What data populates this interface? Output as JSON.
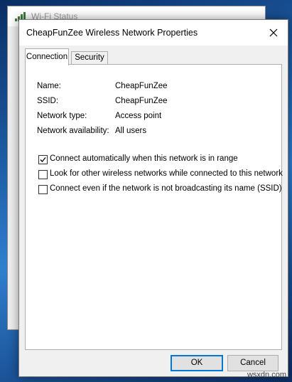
{
  "background_window": {
    "title": "Wi-Fi Status"
  },
  "dialog": {
    "title": "CheapFunZee Wireless Network Properties",
    "tabs": [
      {
        "label": "Connection",
        "active": true
      },
      {
        "label": "Security",
        "active": false
      }
    ],
    "info": [
      {
        "label": "Name:",
        "value": "CheapFunZee"
      },
      {
        "label": "SSID:",
        "value": "CheapFunZee"
      },
      {
        "label": "Network type:",
        "value": "Access point"
      },
      {
        "label": "Network availability:",
        "value": "All users"
      }
    ],
    "options": [
      {
        "label": "Connect automatically when this network is in range",
        "checked": true
      },
      {
        "label": "Look for other wireless networks while connected to this network",
        "checked": false
      },
      {
        "label": "Connect even if the network is not broadcasting its name (SSID)",
        "checked": false
      }
    ],
    "buttons": {
      "ok": "OK",
      "cancel": "Cancel"
    }
  },
  "watermark": "wsxdn.com",
  "colors": {
    "accent": "#0078d7",
    "wifi_icon": "#2a8a2a"
  }
}
